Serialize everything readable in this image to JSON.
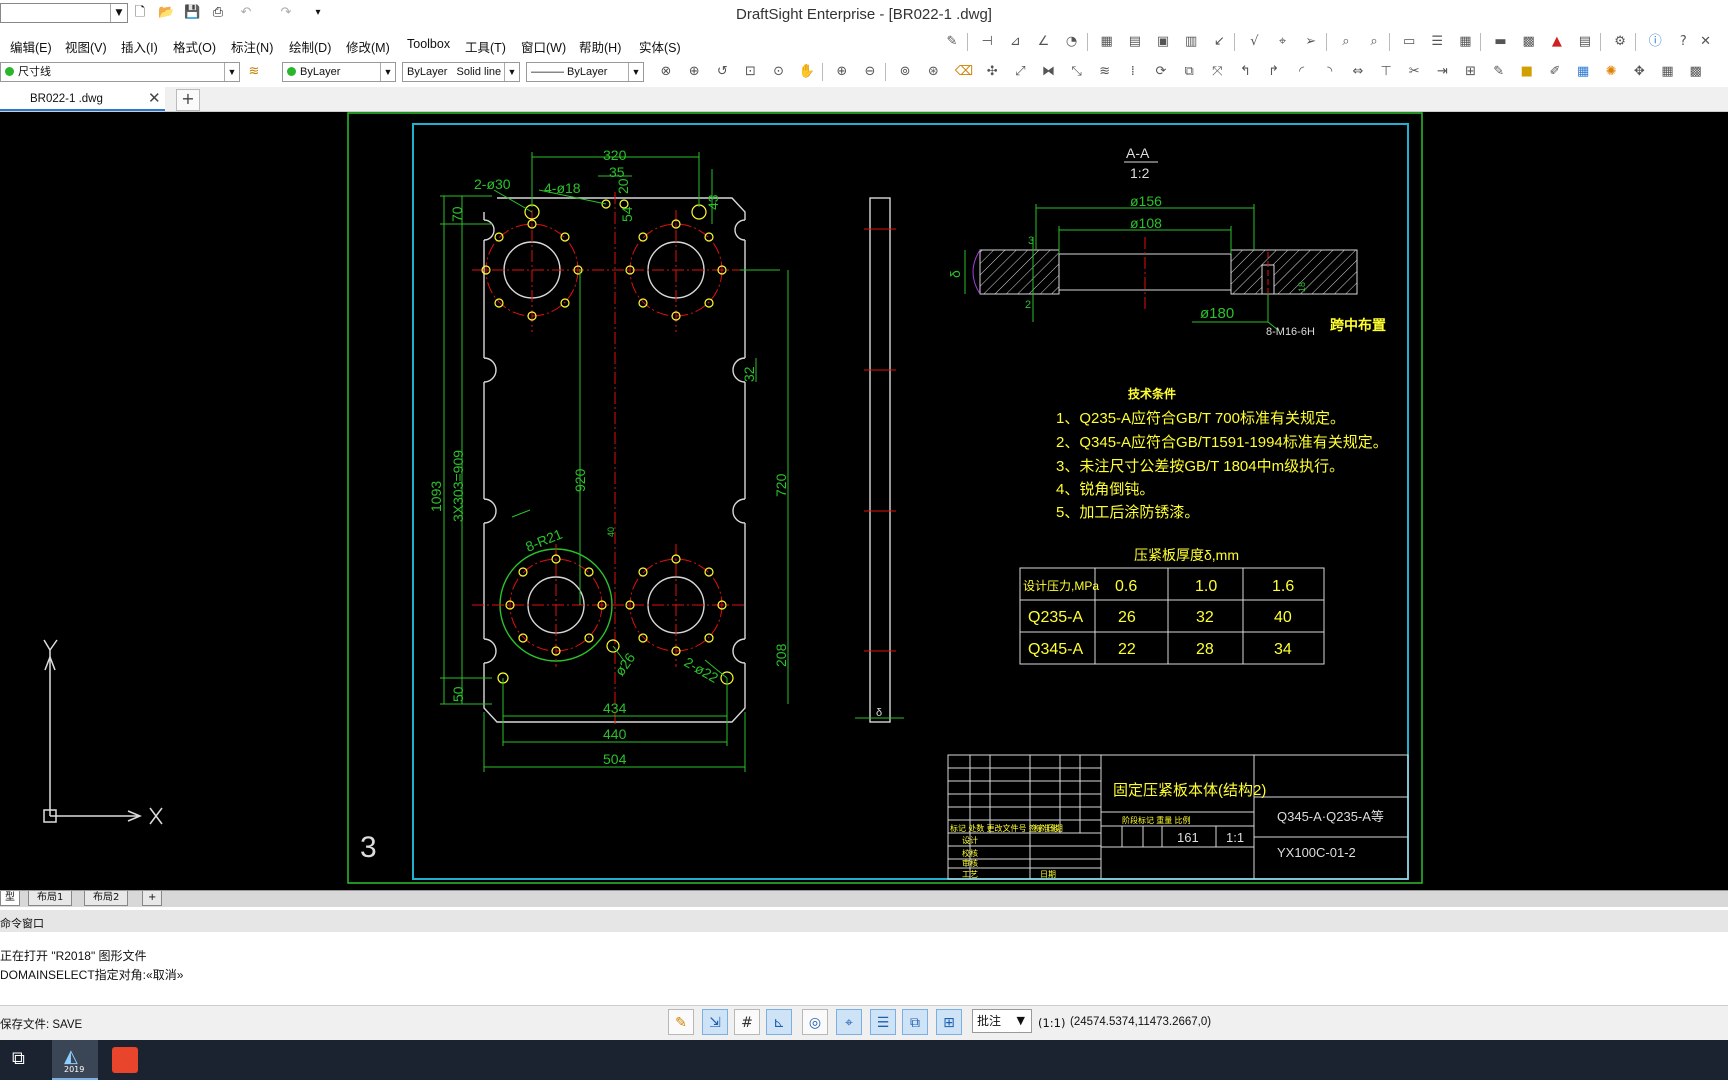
{
  "window": {
    "title": "DraftSight Enterprise - [BR022-1 .dwg]"
  },
  "menu": [
    "编辑(E)",
    "视图(V)",
    "插入(I)",
    "格式(O)",
    "标注(N)",
    "绘制(D)",
    "修改(M)",
    "Toolbox",
    "工具(T)",
    "窗口(W)",
    "帮助(H)",
    "实体(S)"
  ],
  "props": {
    "layer": "尺寸线",
    "color": "ByLayer",
    "linestyle": "ByLayer",
    "linestyle_name": "Solid line",
    "lineweight": "——— ByLayer"
  },
  "doc_tab": {
    "label": "BR022-1 .dwg",
    "close": "✕",
    "new": "+"
  },
  "colors": {
    "canvas": "#000000",
    "frame": "#22b0d0",
    "outer_frame": "#2bc12b",
    "dim": "#2bc12b",
    "center": "#e01010",
    "text": "#ffff30",
    "body": "#ffff30"
  },
  "drawing": {
    "dims": {
      "d320": "320",
      "d35": "35",
      "d2phi30": "2-ø30",
      "d4phi18": "4-ø18",
      "d20": "20",
      "d70": "70",
      "d43": "43",
      "d54": "54",
      "d1093": "1093",
      "d909": "3X303=909",
      "d920": "920",
      "d720": "720",
      "d32": "32",
      "d8r21": "8-R21",
      "d50": "50",
      "d208": "208",
      "dphi26": "ø26",
      "d2phi22": "2-ø22",
      "d434": "434",
      "d440": "440",
      "d504": "504",
      "d40": "40",
      "delta": "δ"
    },
    "sheet_no": "3",
    "section": {
      "title": "A-A",
      "scale": "1:2",
      "d156": "ø156",
      "d108": "ø108",
      "d3": "3",
      "d2": "2",
      "delta": "δ",
      "d180": "ø180",
      "d18": "18",
      "note1": "8-M16-6H",
      "note2": "跨中布置"
    },
    "tech": {
      "title": "技术条件",
      "items": [
        "1、Q235-A应符合GB/T 700标准有关规定。",
        "2、Q345-A应符合GB/T1591-1994标准有关规定。",
        "3、未注尺寸公差按GB/T 1804中m级执行。",
        "4、锐角倒钝。",
        "5、加工后涂防锈漆。"
      ]
    },
    "thickness": {
      "caption": "压紧板厚度δ,mm",
      "header": [
        "设计压力,MPa",
        "0.6",
        "1.0",
        "1.6"
      ],
      "rows": [
        [
          "Q235-A",
          "26",
          "32",
          "40"
        ],
        [
          "Q345-A",
          "22",
          "28",
          "34"
        ]
      ]
    },
    "titleblock": {
      "name": "固定压紧板本体(结构2)",
      "material": "Q345-A·Q235-A等",
      "code": "YX100C-01-2",
      "weight": "161",
      "ratio": "1:1",
      "hdr": "标记  处数  更改文件号  签字  日期",
      "r1": "设计",
      "r1b": "标准化",
      "r2": "校核",
      "r3": "审核",
      "r4": "工艺",
      "r4b": "日期",
      "stage": "阶段标记  重量  比例"
    }
  },
  "layout_tabs": [
    "型",
    "布局1",
    "布局2",
    "+"
  ],
  "command": {
    "header": "命令窗口",
    "lines": [
      "正在打开 \"R2018\" 图形文件",
      "DOMAINSELECT指定对角:«取消»"
    ],
    "status": "保存文件: SAVE"
  },
  "status": {
    "annotation": "批注",
    "scale": "(1:1)",
    "coords": "(24574.5374,11473.2667,0)"
  },
  "taskbar": {
    "app_label": "2019"
  }
}
